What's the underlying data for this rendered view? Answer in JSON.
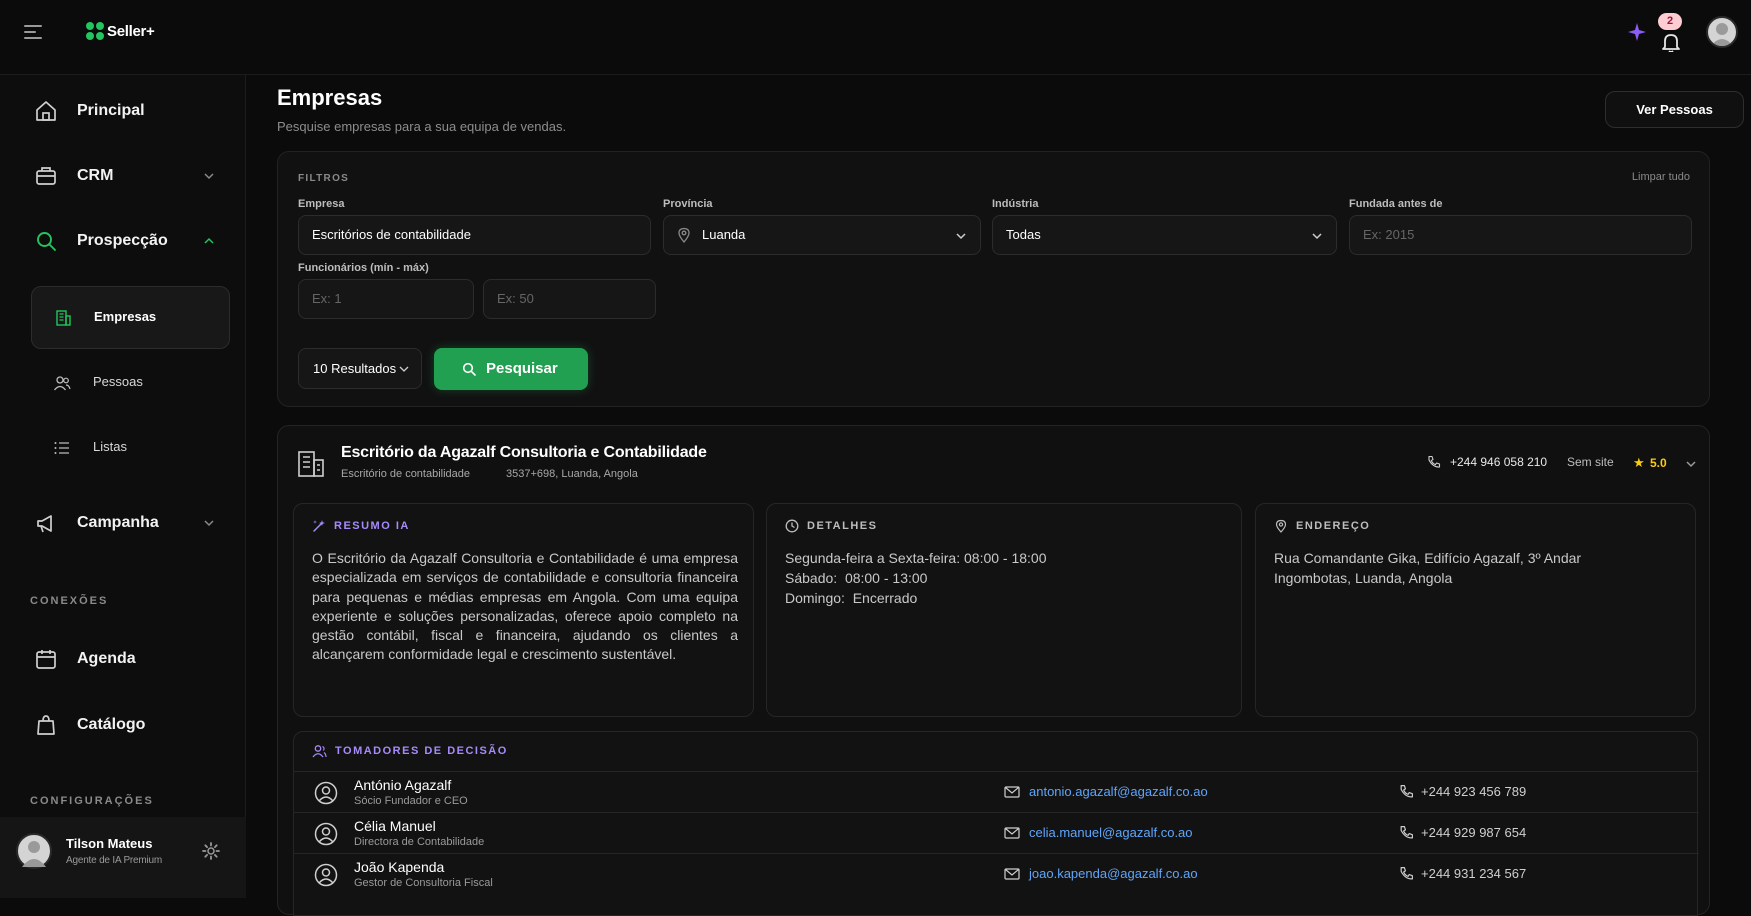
{
  "app": {
    "name": "Seller+",
    "notifications": "2"
  },
  "sidebar": {
    "items": [
      {
        "label": "Principal"
      },
      {
        "label": "CRM"
      },
      {
        "label": "Prospecção"
      },
      {
        "label": "Campanha"
      },
      {
        "label": "Agenda"
      },
      {
        "label": "Catálogo"
      }
    ],
    "sub_items": [
      {
        "label": "Empresas"
      },
      {
        "label": "Pessoas"
      },
      {
        "label": "Listas"
      }
    ],
    "sections": {
      "connections": "CONEXÕES",
      "settings": "CONFIGURAÇÕES"
    },
    "user": {
      "name": "Tilson Mateus",
      "role": "Agente de IA Premium"
    }
  },
  "page": {
    "title": "Empresas",
    "subtitle": "Pesquise empresas para a sua equipa de vendas.",
    "people_button": "Ver Pessoas"
  },
  "filters": {
    "title": "FILTROS",
    "clear": "Limpar tudo",
    "company_label": "Empresa",
    "company_value": "Escritórios de contabilidade",
    "province_label": "Província",
    "province_value": "Luanda",
    "industry_label": "Indústria",
    "industry_value": "Todas",
    "founded_label": "Fundada antes de",
    "founded_placeholder": "Ex: 2015",
    "employees_label": "Funcionários (mín - máx)",
    "min_placeholder": "Ex: 1",
    "max_placeholder": "Ex: 50",
    "results": "10 Resultados",
    "search_button": "Pesquisar"
  },
  "company": {
    "name": "Escritório da Agazalf Consultoria e Contabilidade",
    "type": "Escritório de contabilidade",
    "address_short": "3537+698, Luanda, Angola",
    "phone": "+244 946 058 210",
    "website": "Sem site",
    "rating": "5.0",
    "summary_title": "RESUMO IA",
    "summary": "O Escritório da Agazalf Consultoria e Contabilidade é uma empresa especializada em serviços de contabilidade e consultoria financeira para pequenas e médias empresas em Angola. Com uma equipa experiente e soluções personalizadas, oferece apoio completo na gestão contábil, fiscal e financeira, ajudando os clientes a alcançarem conformidade legal e crescimento sustentável.",
    "details_title": "DETALHES",
    "hours": [
      "Segunda-feira a Sexta-feira: 08:00 - 18:00",
      "Sábado:  08:00 - 13:00",
      "Domingo:  Encerrado"
    ],
    "address_title": "ENDEREÇO",
    "address_lines": [
      "Rua Comandante Gika, Edifício Agazalf, 3º Andar",
      "Ingombotas, Luanda, Angola"
    ],
    "decision_title": "TOMADORES DE DECISÃO",
    "decision_makers": [
      {
        "name": "António Agazalf",
        "role": "Sócio Fundador e CEO",
        "email": "antonio.agazalf@agazalf.co.ao",
        "phone": "+244 923 456 789"
      },
      {
        "name": "Célia Manuel",
        "role": "Directora de Contabilidade",
        "email": "celia.manuel@agazalf.co.ao",
        "phone": "+244 929 987 654"
      },
      {
        "name": "João Kapenda",
        "role": "Gestor de Consultoria Fiscal",
        "email": "joao.kapenda@agazalf.co.ao",
        "phone": "+244 931 234 567"
      }
    ]
  },
  "colors": {
    "accent": "#22a052",
    "ai_purple": "#a78bfa",
    "link": "#60a5fa",
    "star": "#facc15"
  }
}
